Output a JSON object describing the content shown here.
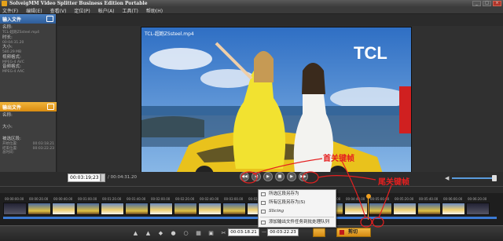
{
  "window": {
    "title": "SolveigMM Video Splitter Business Edition Portable",
    "buttons": [
      "_",
      "□",
      "×"
    ]
  },
  "menubar": {
    "items": [
      "文件(F)",
      "编辑(E)",
      "查看(V)",
      "定位(P)",
      "帐户(A)",
      "工具(T)",
      "帮助(H)"
    ]
  },
  "input_panel": {
    "header": "输入文件",
    "labels": {
      "name": "名称:",
      "name_value": "TCL-超跑ZSsteel.mp4",
      "duration": "时长:",
      "duration_value": "00:04:31.20",
      "size": "大小:",
      "size_value": "580.29 MB",
      "video_format": "视频格式:",
      "video_format_value": "MPEG-4 AVC",
      "audio_format": "音频格式:",
      "audio_format_value": "MPEG-4 AAC"
    }
  },
  "output_panel": {
    "header": "输出文件",
    "labels": {
      "name": "名称:",
      "size": "大小:",
      "selected": "被选区段:",
      "start_label": "开始位置:",
      "start_value": "00:03:18.21",
      "end_label": "结束位置:",
      "end_value": "00:03:22.23",
      "total_label": "总时间:"
    }
  },
  "video": {
    "filename": "TCL-超跑ZSsteel.mp4",
    "logo": "TCL"
  },
  "controls": {
    "current_time": "00:03:19;23",
    "duration": "/ 00:04:31.20"
  },
  "timeline": {
    "times": [
      "00:00:00.00",
      "00:00:20.00",
      "00:00:40.00",
      "00:01:00.00",
      "00:01:20.00",
      "00:01:40.00",
      "00:02:00.00",
      "00:02:20.00",
      "00:02:40.00",
      "00:03:00.00",
      "00:03:20.00",
      "00:03:40.00",
      "00:04:00.00",
      "00:04:20.00",
      "00:04:40.00",
      "00:05:00.00",
      "00:05:20.00",
      "00:05:40.00",
      "00:06:00.00",
      "00:06:20.00"
    ]
  },
  "context_menu": {
    "items": [
      "所选区段另存为",
      "所有区段另存为(S)",
      "Slicing",
      "添加输出文件任务到批处理队列"
    ]
  },
  "bottombar": {
    "start_time": "00:03:18.21",
    "end_time": "00:03:22.23",
    "split_label": "剪切"
  },
  "annotations": {
    "first_keyframe": "首关键帧",
    "last_keyframe": "尾关键帧"
  },
  "colors": {
    "accent_orange": "#e8a01e",
    "annotation_red": "#e52020",
    "timeline_blue": "#3b7ad4"
  }
}
